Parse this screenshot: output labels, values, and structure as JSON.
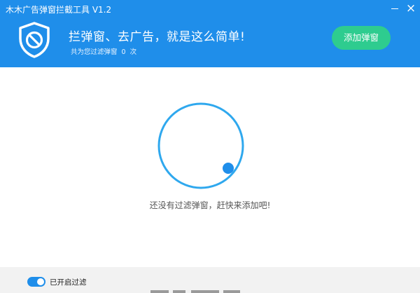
{
  "window": {
    "title": "木木广告弹窗拦截工具  V1.2",
    "minimize_icon": "minimize-icon",
    "close_icon": "close-icon",
    "close_glyph": "×"
  },
  "header": {
    "logo_icon": "shield-block-icon",
    "slogan": "拦弹窗、去广告，就是这么简单!",
    "count_prefix": "共为您过滤弹窗",
    "count_value": "0",
    "count_suffix": "次",
    "add_button": "添加弹窗"
  },
  "main": {
    "empty_icon": "empty-ring-icon",
    "empty_text": "还没有过滤弹窗，赶快来添加吧!"
  },
  "footer": {
    "filter_label": "已开启过滤",
    "filter_enabled": true
  },
  "colors": {
    "primary": "#1f8eea",
    "accent_green": "#2ecc8f",
    "footer_bg": "#f2f2f2"
  }
}
